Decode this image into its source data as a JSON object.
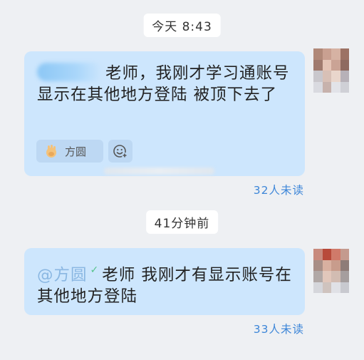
{
  "messages": [
    {
      "timestamp": "今天 8:43",
      "text": "老师，我刚才学习通账号显示在其他地方登陆 被顶下去了",
      "reaction_name": "方圆",
      "unread": "32人未读"
    },
    {
      "timestamp": "41分钟前",
      "mention": "@方圆",
      "text": "老师 我刚才有显示账号在其他地方登陆",
      "unread": "33人未读"
    }
  ],
  "icons": {
    "verified": "check-icon",
    "emoji": "emoji-add-icon"
  },
  "colors": {
    "bubble": "#cde6fd",
    "unread_link": "#3d86d8",
    "background": "#eef0f3"
  }
}
